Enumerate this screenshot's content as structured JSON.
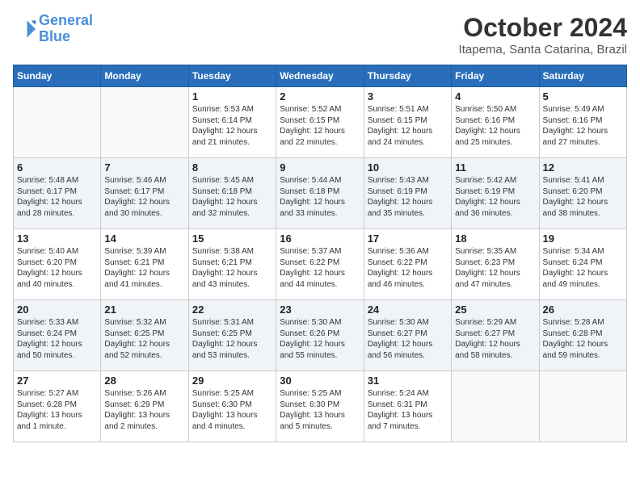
{
  "header": {
    "logo_line1": "General",
    "logo_line2": "Blue",
    "month": "October 2024",
    "location": "Itapema, Santa Catarina, Brazil"
  },
  "days_of_week": [
    "Sunday",
    "Monday",
    "Tuesday",
    "Wednesday",
    "Thursday",
    "Friday",
    "Saturday"
  ],
  "weeks": [
    [
      {
        "day": "",
        "sunrise": "",
        "sunset": "",
        "daylight": ""
      },
      {
        "day": "",
        "sunrise": "",
        "sunset": "",
        "daylight": ""
      },
      {
        "day": "1",
        "sunrise": "Sunrise: 5:53 AM",
        "sunset": "Sunset: 6:14 PM",
        "daylight": "Daylight: 12 hours and 21 minutes."
      },
      {
        "day": "2",
        "sunrise": "Sunrise: 5:52 AM",
        "sunset": "Sunset: 6:15 PM",
        "daylight": "Daylight: 12 hours and 22 minutes."
      },
      {
        "day": "3",
        "sunrise": "Sunrise: 5:51 AM",
        "sunset": "Sunset: 6:15 PM",
        "daylight": "Daylight: 12 hours and 24 minutes."
      },
      {
        "day": "4",
        "sunrise": "Sunrise: 5:50 AM",
        "sunset": "Sunset: 6:16 PM",
        "daylight": "Daylight: 12 hours and 25 minutes."
      },
      {
        "day": "5",
        "sunrise": "Sunrise: 5:49 AM",
        "sunset": "Sunset: 6:16 PM",
        "daylight": "Daylight: 12 hours and 27 minutes."
      }
    ],
    [
      {
        "day": "6",
        "sunrise": "Sunrise: 5:48 AM",
        "sunset": "Sunset: 6:17 PM",
        "daylight": "Daylight: 12 hours and 28 minutes."
      },
      {
        "day": "7",
        "sunrise": "Sunrise: 5:46 AM",
        "sunset": "Sunset: 6:17 PM",
        "daylight": "Daylight: 12 hours and 30 minutes."
      },
      {
        "day": "8",
        "sunrise": "Sunrise: 5:45 AM",
        "sunset": "Sunset: 6:18 PM",
        "daylight": "Daylight: 12 hours and 32 minutes."
      },
      {
        "day": "9",
        "sunrise": "Sunrise: 5:44 AM",
        "sunset": "Sunset: 6:18 PM",
        "daylight": "Daylight: 12 hours and 33 minutes."
      },
      {
        "day": "10",
        "sunrise": "Sunrise: 5:43 AM",
        "sunset": "Sunset: 6:19 PM",
        "daylight": "Daylight: 12 hours and 35 minutes."
      },
      {
        "day": "11",
        "sunrise": "Sunrise: 5:42 AM",
        "sunset": "Sunset: 6:19 PM",
        "daylight": "Daylight: 12 hours and 36 minutes."
      },
      {
        "day": "12",
        "sunrise": "Sunrise: 5:41 AM",
        "sunset": "Sunset: 6:20 PM",
        "daylight": "Daylight: 12 hours and 38 minutes."
      }
    ],
    [
      {
        "day": "13",
        "sunrise": "Sunrise: 5:40 AM",
        "sunset": "Sunset: 6:20 PM",
        "daylight": "Daylight: 12 hours and 40 minutes."
      },
      {
        "day": "14",
        "sunrise": "Sunrise: 5:39 AM",
        "sunset": "Sunset: 6:21 PM",
        "daylight": "Daylight: 12 hours and 41 minutes."
      },
      {
        "day": "15",
        "sunrise": "Sunrise: 5:38 AM",
        "sunset": "Sunset: 6:21 PM",
        "daylight": "Daylight: 12 hours and 43 minutes."
      },
      {
        "day": "16",
        "sunrise": "Sunrise: 5:37 AM",
        "sunset": "Sunset: 6:22 PM",
        "daylight": "Daylight: 12 hours and 44 minutes."
      },
      {
        "day": "17",
        "sunrise": "Sunrise: 5:36 AM",
        "sunset": "Sunset: 6:22 PM",
        "daylight": "Daylight: 12 hours and 46 minutes."
      },
      {
        "day": "18",
        "sunrise": "Sunrise: 5:35 AM",
        "sunset": "Sunset: 6:23 PM",
        "daylight": "Daylight: 12 hours and 47 minutes."
      },
      {
        "day": "19",
        "sunrise": "Sunrise: 5:34 AM",
        "sunset": "Sunset: 6:24 PM",
        "daylight": "Daylight: 12 hours and 49 minutes."
      }
    ],
    [
      {
        "day": "20",
        "sunrise": "Sunrise: 5:33 AM",
        "sunset": "Sunset: 6:24 PM",
        "daylight": "Daylight: 12 hours and 50 minutes."
      },
      {
        "day": "21",
        "sunrise": "Sunrise: 5:32 AM",
        "sunset": "Sunset: 6:25 PM",
        "daylight": "Daylight: 12 hours and 52 minutes."
      },
      {
        "day": "22",
        "sunrise": "Sunrise: 5:31 AM",
        "sunset": "Sunset: 6:25 PM",
        "daylight": "Daylight: 12 hours and 53 minutes."
      },
      {
        "day": "23",
        "sunrise": "Sunrise: 5:30 AM",
        "sunset": "Sunset: 6:26 PM",
        "daylight": "Daylight: 12 hours and 55 minutes."
      },
      {
        "day": "24",
        "sunrise": "Sunrise: 5:30 AM",
        "sunset": "Sunset: 6:27 PM",
        "daylight": "Daylight: 12 hours and 56 minutes."
      },
      {
        "day": "25",
        "sunrise": "Sunrise: 5:29 AM",
        "sunset": "Sunset: 6:27 PM",
        "daylight": "Daylight: 12 hours and 58 minutes."
      },
      {
        "day": "26",
        "sunrise": "Sunrise: 5:28 AM",
        "sunset": "Sunset: 6:28 PM",
        "daylight": "Daylight: 12 hours and 59 minutes."
      }
    ],
    [
      {
        "day": "27",
        "sunrise": "Sunrise: 5:27 AM",
        "sunset": "Sunset: 6:28 PM",
        "daylight": "Daylight: 13 hours and 1 minute."
      },
      {
        "day": "28",
        "sunrise": "Sunrise: 5:26 AM",
        "sunset": "Sunset: 6:29 PM",
        "daylight": "Daylight: 13 hours and 2 minutes."
      },
      {
        "day": "29",
        "sunrise": "Sunrise: 5:25 AM",
        "sunset": "Sunset: 6:30 PM",
        "daylight": "Daylight: 13 hours and 4 minutes."
      },
      {
        "day": "30",
        "sunrise": "Sunrise: 5:25 AM",
        "sunset": "Sunset: 6:30 PM",
        "daylight": "Daylight: 13 hours and 5 minutes."
      },
      {
        "day": "31",
        "sunrise": "Sunrise: 5:24 AM",
        "sunset": "Sunset: 6:31 PM",
        "daylight": "Daylight: 13 hours and 7 minutes."
      },
      {
        "day": "",
        "sunrise": "",
        "sunset": "",
        "daylight": ""
      },
      {
        "day": "",
        "sunrise": "",
        "sunset": "",
        "daylight": ""
      }
    ]
  ]
}
